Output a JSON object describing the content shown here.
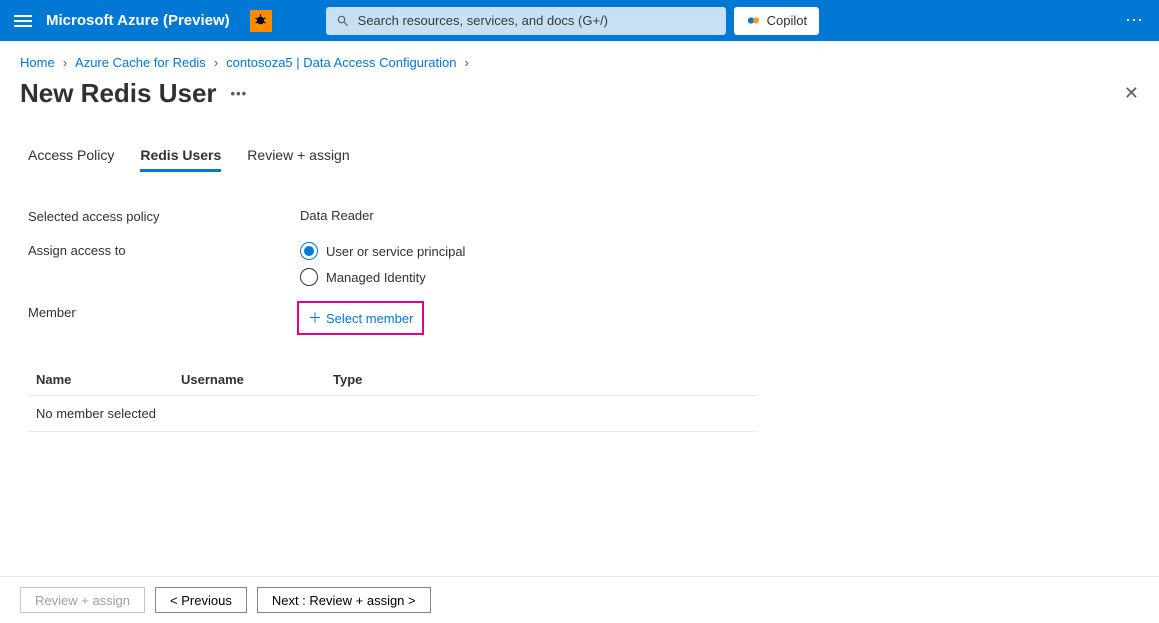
{
  "topbar": {
    "brand": "Microsoft Azure (Preview)",
    "search_placeholder": "Search resources, services, and docs (G+/)",
    "copilot_label": "Copilot"
  },
  "breadcrumb": {
    "items": [
      "Home",
      "Azure Cache for Redis",
      "contosoza5 | Data Access Configuration"
    ]
  },
  "page": {
    "title": "New Redis User"
  },
  "tabs": {
    "items": [
      {
        "label": "Access Policy",
        "active": false
      },
      {
        "label": "Redis Users",
        "active": true
      },
      {
        "label": "Review + assign",
        "active": false
      }
    ]
  },
  "form": {
    "selected_policy_label": "Selected access policy",
    "selected_policy_value": "Data Reader",
    "assign_label": "Assign access to",
    "radio_user": "User or service principal",
    "radio_identity": "Managed Identity",
    "member_label": "Member",
    "select_member_label": "Select member"
  },
  "table": {
    "col_name": "Name",
    "col_user": "Username",
    "col_type": "Type",
    "empty_text": "No member selected"
  },
  "footer": {
    "review_assign": "Review + assign",
    "previous": "< Previous",
    "next": "Next : Review + assign >"
  }
}
